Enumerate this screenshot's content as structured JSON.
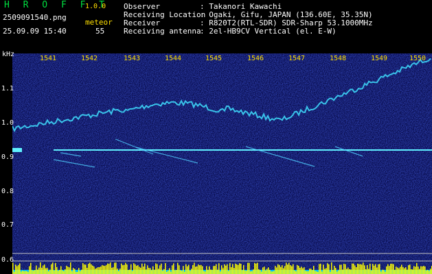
{
  "header": {
    "app_title": "H R O F F T",
    "version": "1.0.0",
    "filename": "2509091540.png",
    "meteor_label": "meteor",
    "datetime": "25.09.09 15:40",
    "meteor_count": "55",
    "info": [
      {
        "label": "Observer",
        "value": ": Takanori Kawachi"
      },
      {
        "label": "Receiving Location",
        "value": ": Ogaki, Gifu, JAPAN (136.60E, 35.35N)"
      },
      {
        "label": "Receiver",
        "value": ": R820T2(RTL-SDR) SDR-Sharp 53.1000MHz"
      },
      {
        "label": "Receiving antenna",
        "value": ": 2el-HB9CV Vertical (el. E-W)"
      }
    ]
  },
  "axes": {
    "y_unit": "kHz",
    "x_ticks": [
      "1541",
      "1542",
      "1543",
      "1544",
      "1545",
      "1546",
      "1547",
      "1548",
      "1549",
      "1550"
    ],
    "y_ticks": [
      "1.1",
      "1.0",
      "0.9",
      "0.8",
      "0.7",
      "0.6"
    ]
  },
  "colors": {
    "background": "#0a0a5a",
    "trace": "#40e0ff",
    "tick_label": "#ffe000",
    "title_green": "#00e040",
    "bottom_bars": "#ffff00",
    "bottom_base": "#00c0ff"
  }
}
